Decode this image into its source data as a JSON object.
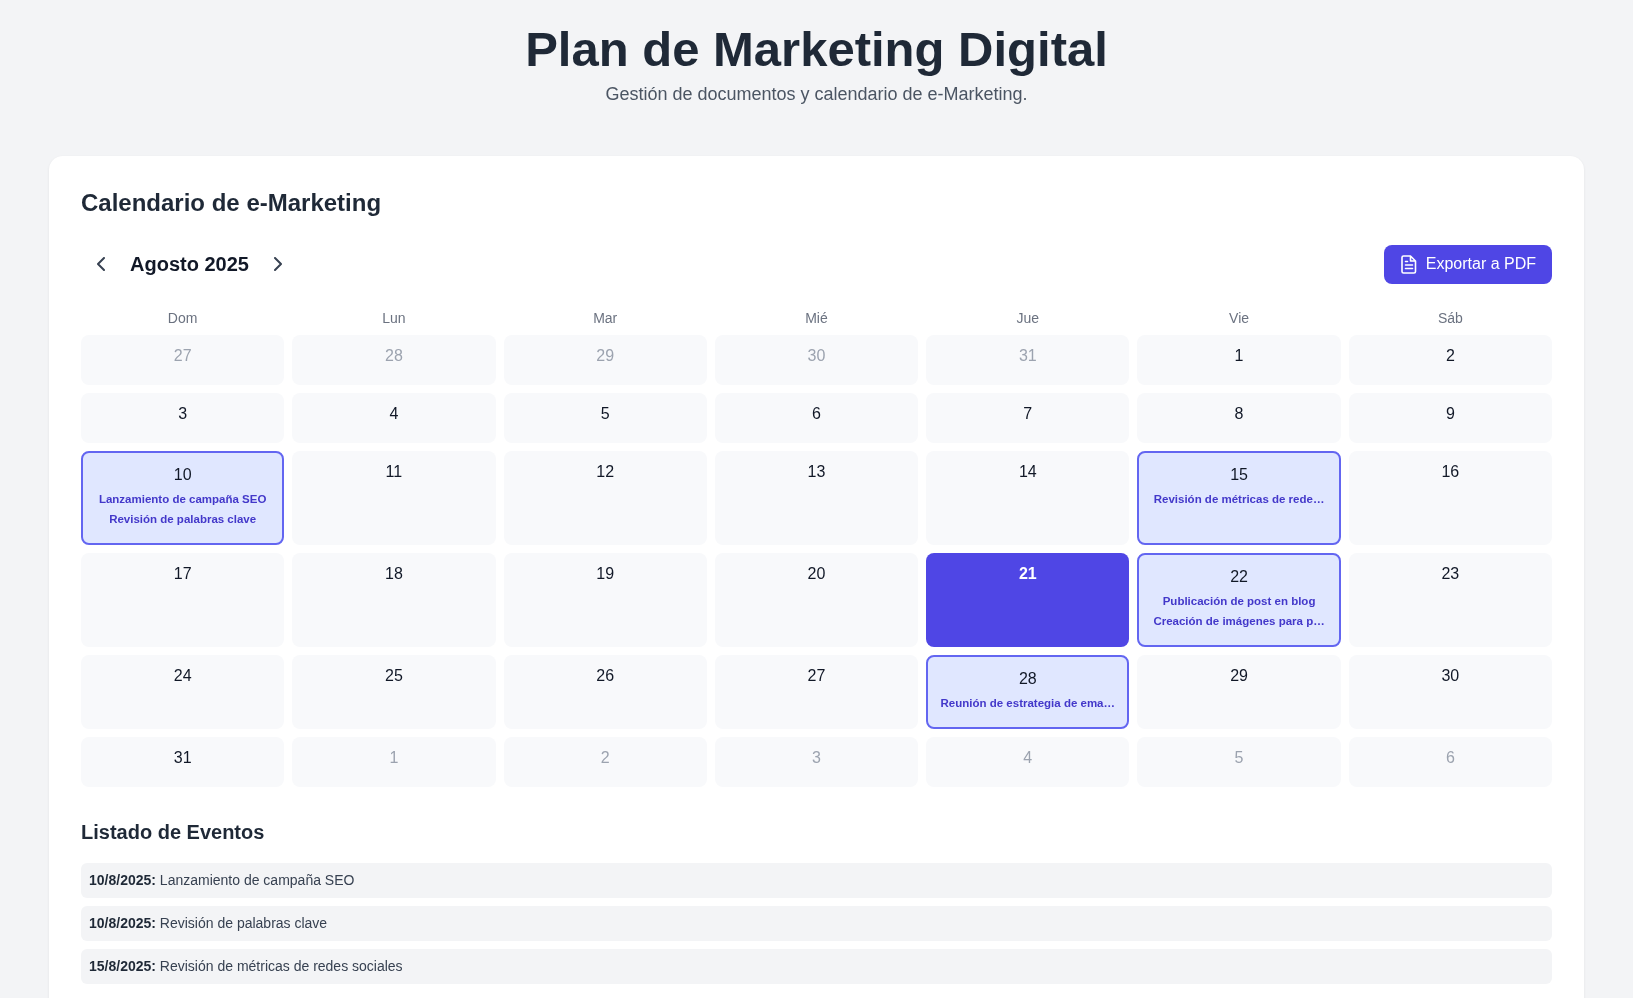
{
  "header": {
    "title": "Plan de Marketing Digital",
    "subtitle": "Gestión de documentos y calendario de e-Marketing."
  },
  "calendar": {
    "title": "Calendario de e-Marketing",
    "month": "Agosto 2025",
    "export_button": "Exportar a PDF",
    "weekdays": [
      "Dom",
      "Lun",
      "Mar",
      "Mié",
      "Jue",
      "Vie",
      "Sáb"
    ],
    "weeks": [
      {
        "days": [
          {
            "day": "27",
            "outside_month": true,
            "today": false
          },
          {
            "day": "28",
            "outside_month": true,
            "today": false
          },
          {
            "day": "29",
            "outside_month": true,
            "today": false
          },
          {
            "day": "30",
            "outside_month": true,
            "today": false
          },
          {
            "day": "31",
            "outside_month": true,
            "today": false
          },
          {
            "day": "1",
            "outside_month": false,
            "today": false
          },
          {
            "day": "2",
            "outside_month": false,
            "today": false
          }
        ]
      },
      {
        "days": [
          {
            "day": "3",
            "outside_month": false,
            "today": false
          },
          {
            "day": "4",
            "outside_month": false,
            "today": false
          },
          {
            "day": "5",
            "outside_month": false,
            "today": false
          },
          {
            "day": "6",
            "outside_month": false,
            "today": false
          },
          {
            "day": "7",
            "outside_month": false,
            "today": false
          },
          {
            "day": "8",
            "outside_month": false,
            "today": false
          },
          {
            "day": "9",
            "outside_month": false,
            "today": false
          }
        ]
      },
      {
        "days": [
          {
            "day": "10",
            "outside_month": false,
            "today": false,
            "events": [
              "Lanzamiento de campaña SEO",
              "Revisión de palabras clave"
            ]
          },
          {
            "day": "11",
            "outside_month": false,
            "today": false
          },
          {
            "day": "12",
            "outside_month": false,
            "today": false
          },
          {
            "day": "13",
            "outside_month": false,
            "today": false
          },
          {
            "day": "14",
            "outside_month": false,
            "today": false
          },
          {
            "day": "15",
            "outside_month": false,
            "today": false,
            "events": [
              "Revisión de métricas de rede…"
            ]
          },
          {
            "day": "16",
            "outside_month": false,
            "today": false
          }
        ]
      },
      {
        "days": [
          {
            "day": "17",
            "outside_month": false,
            "today": false
          },
          {
            "day": "18",
            "outside_month": false,
            "today": false
          },
          {
            "day": "19",
            "outside_month": false,
            "today": false
          },
          {
            "day": "20",
            "outside_month": false,
            "today": false
          },
          {
            "day": "21",
            "outside_month": false,
            "today": true
          },
          {
            "day": "22",
            "outside_month": false,
            "today": false,
            "events": [
              "Publicación de post en blog",
              "Creación de imágenes para p…"
            ]
          },
          {
            "day": "23",
            "outside_month": false,
            "today": false
          }
        ]
      },
      {
        "days": [
          {
            "day": "24",
            "outside_month": false,
            "today": false
          },
          {
            "day": "25",
            "outside_month": false,
            "today": false
          },
          {
            "day": "26",
            "outside_month": false,
            "today": false
          },
          {
            "day": "27",
            "outside_month": false,
            "today": false
          },
          {
            "day": "28",
            "outside_month": false,
            "today": false,
            "events": [
              "Reunión de estrategia de ema…"
            ]
          },
          {
            "day": "29",
            "outside_month": false,
            "today": false
          },
          {
            "day": "30",
            "outside_month": false,
            "today": false
          }
        ]
      },
      {
        "days": [
          {
            "day": "31",
            "outside_month": false,
            "today": false
          },
          {
            "day": "1",
            "outside_month": true,
            "today": false
          },
          {
            "day": "2",
            "outside_month": true,
            "today": false
          },
          {
            "day": "3",
            "outside_month": true,
            "today": false
          },
          {
            "day": "4",
            "outside_month": true,
            "today": false
          },
          {
            "day": "5",
            "outside_month": true,
            "today": false
          },
          {
            "day": "6",
            "outside_month": true,
            "today": false
          }
        ]
      }
    ]
  },
  "event_list": {
    "title": "Listado de Eventos",
    "items": [
      "**10/8/2025:** Lanzamiento de campaña SEO",
      "**10/8/2025:** Revisión de palabras clave",
      "**15/8/2025:** Revisión de métricas de redes sociales"
    ]
  }
}
